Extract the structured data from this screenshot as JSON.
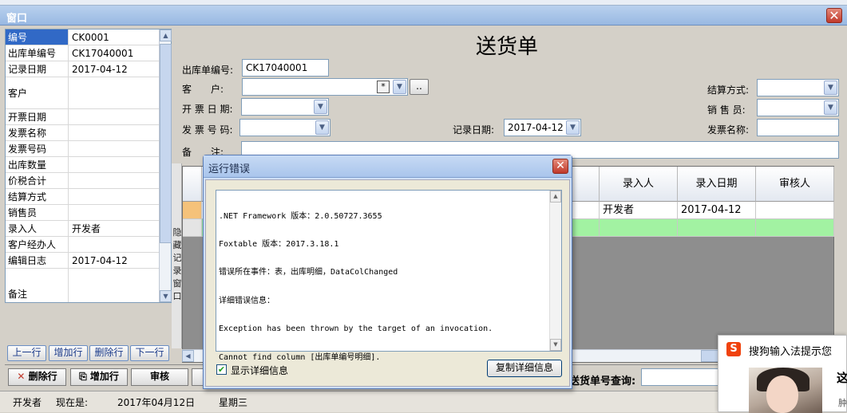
{
  "window": {
    "title": "窗口"
  },
  "left_panel": {
    "rows": [
      {
        "key": "编号",
        "value": "CK0001"
      },
      {
        "key": "出库单编号",
        "value": "CK17040001"
      },
      {
        "key": "记录日期",
        "value": "2017-04-12"
      },
      {
        "key": "客户",
        "value": ""
      },
      {
        "key": "开票日期",
        "value": ""
      },
      {
        "key": "发票名称",
        "value": ""
      },
      {
        "key": "发票号码",
        "value": ""
      },
      {
        "key": "出库数量",
        "value": ""
      },
      {
        "key": "价税合计",
        "value": ""
      },
      {
        "key": "结算方式",
        "value": ""
      },
      {
        "key": "销售员",
        "value": ""
      },
      {
        "key": "录入人",
        "value": "开发者"
      },
      {
        "key": "客户经办人",
        "value": ""
      },
      {
        "key": "编辑日志",
        "value": "2017-04-12"
      },
      {
        "key": "备注",
        "value": ""
      }
    ],
    "nav": {
      "prev": "上一行",
      "add": "增加行",
      "delete": "删除行",
      "next": "下一行"
    }
  },
  "form": {
    "title": "送货单",
    "fields": {
      "order_no_label": "出库单编号:",
      "order_no_value": "CK17040001",
      "customer_label": "客　　户:",
      "customer_value": "",
      "customer_star": "*",
      "customer_more": "..",
      "invoice_date_label": "开 票 日 期:",
      "invoice_no_label": "发 票 号 码:",
      "record_date_label": "记录日期:",
      "record_date_value": "2017-04-12",
      "settlement_label": "结算方式:",
      "salesperson_label": "销 售 员:",
      "invoice_name_label": "发票名称:",
      "notes_label": "备　　注:"
    }
  },
  "grid": {
    "headers": [
      "录入人",
      "录入日期",
      "审核人"
    ],
    "rows": [
      [
        "开发者",
        "2017-04-12",
        ""
      ],
      [
        "",
        "",
        ""
      ]
    ]
  },
  "side_label": "隐藏记录窗口",
  "toolbar": {
    "delete_row": "删除行",
    "add_row": "增加行",
    "review": "审核",
    "query_label": "送货单号查询:"
  },
  "status_bar": {
    "user": "开发者",
    "now_label": "现在是:",
    "date": "2017年04月12日",
    "weekday": "星期三"
  },
  "dialog": {
    "title": "运行错误",
    "lines": [
      ".NET Framework 版本：2.0.50727.3655",
      "Foxtable 版本：2017.3.18.1",
      "错误所在事件：表，出库明细，DataColChanged",
      "详细错误信息：",
      "Exception has been thrown by the target of an invocation.",
      "Cannot find column [出库单编号明细]."
    ],
    "show_details": "显示详细信息",
    "copy_details": "复制详细信息"
  },
  "ime_popup": {
    "title": "搜狗输入法提示您",
    "logo": "S",
    "more_text": "这",
    "more_text2": "肿"
  }
}
